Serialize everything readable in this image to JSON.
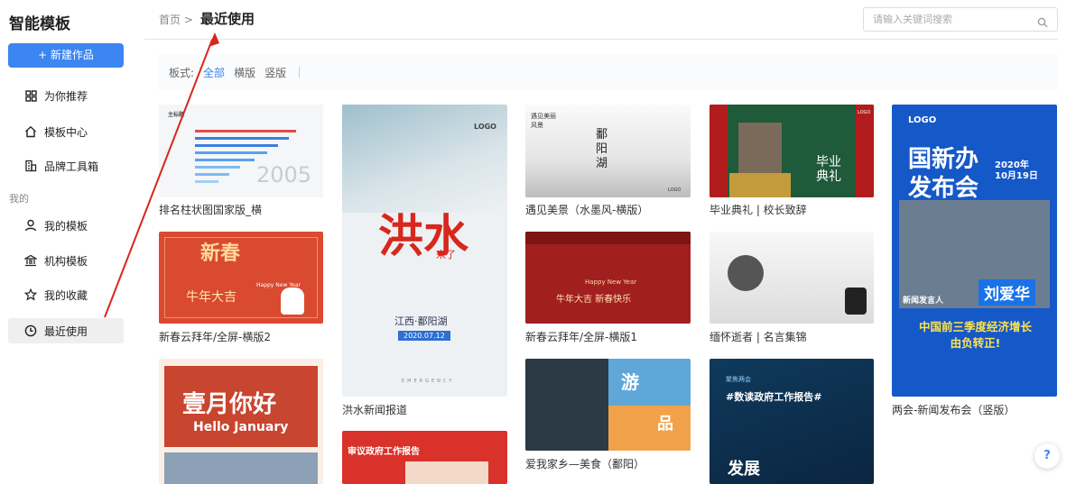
{
  "sidebar": {
    "brand": "智能模板",
    "new_button": "+ 新建作品",
    "items": [
      {
        "label": "为你推荐"
      },
      {
        "label": "模板中心"
      },
      {
        "label": "品牌工具箱"
      }
    ],
    "group": "我的",
    "my_items": [
      {
        "label": "我的模板"
      },
      {
        "label": "机构模板"
      },
      {
        "label": "我的收藏"
      },
      {
        "label": "最近使用"
      }
    ]
  },
  "header": {
    "home": "首页 >",
    "current": "最近使用",
    "search_placeholder": "请输入关键词搜索"
  },
  "filter": {
    "label": "板式:",
    "options": [
      "全部",
      "横版",
      "竖版"
    ],
    "selected": "全部"
  },
  "cards": [
    {
      "title": "排名柱状图国家版_横",
      "thumb_texts": [
        "主标题",
        "2005"
      ]
    },
    {
      "title": "新春云拜年/全屏-横版2",
      "thumb_texts": [
        "新春",
        "牛年大吉",
        "Happy New Year"
      ]
    },
    {
      "title": "",
      "thumb_texts": [
        "壹月你好",
        "Hello January"
      ]
    },
    {
      "title": "洪水新闻报道",
      "thumb_texts": [
        "LOGO",
        "洪水",
        "来了",
        "江西·鄱阳湖",
        "2020.07.12",
        "EMERGENCY"
      ]
    },
    {
      "title": "",
      "thumb_texts": [
        "审议政府工作报告"
      ]
    },
    {
      "title": "遇见美景（水墨风-横版）",
      "thumb_texts": [
        "遇见美丽风景",
        "鄱阳湖",
        "LOGO"
      ]
    },
    {
      "title": "新春云拜年/全屏-横版1",
      "thumb_texts": [
        "Happy New Year",
        "牛年大吉 新春快乐"
      ]
    },
    {
      "title": "爱我家乡—美食（鄱阳）",
      "thumb_texts": [
        "游",
        "品"
      ]
    },
    {
      "title": "毕业典礼 | 校长致辞",
      "thumb_texts": [
        "LOGO",
        "毕业典礼"
      ]
    },
    {
      "title": "缅怀逝者 | 名言集锦",
      "thumb_texts": []
    },
    {
      "title": "",
      "thumb_texts": [
        "聚焦两会",
        "#数读政府工作报告#",
        "发展"
      ]
    },
    {
      "title": "两会-新闻发布会（竖版）",
      "thumb_texts": [
        "LOGO",
        "国新办",
        "发布会",
        "2020年",
        "10月19日",
        "新闻发言人",
        "刘爱华",
        "中国前三季度经济增长",
        "由负转正!"
      ]
    }
  ],
  "help": "?"
}
